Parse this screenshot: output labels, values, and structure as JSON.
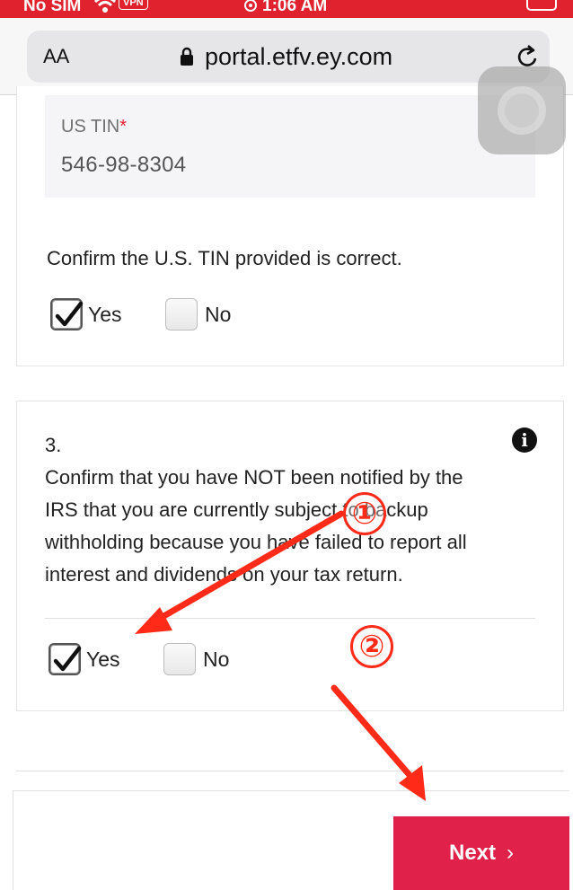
{
  "status_bar": {
    "carrier": "No SIM",
    "vpn": "VPN",
    "time": "1:06 AM"
  },
  "browser": {
    "text_size": "AA",
    "url": "portal.etfv.ey.com"
  },
  "tin": {
    "label": "US TIN",
    "required_mark": "*",
    "value": "546-98-8304"
  },
  "question2": {
    "prompt": "Confirm the U.S. TIN provided is correct.",
    "yes_label": "Yes",
    "yes_checked": true,
    "no_label": "No",
    "no_checked": false
  },
  "question3": {
    "number": "3.",
    "prompt_lines": [
      "Confirm that you have NOT been notified by the",
      "IRS that you are currently subject to backup",
      "withholding because you have failed to report all",
      "interest and dividends on your tax return."
    ],
    "yes_label": "Yes",
    "yes_checked": true,
    "no_label": "No",
    "no_checked": false
  },
  "next_button": {
    "label": "Next",
    "chevron": "›"
  },
  "annotations": {
    "step1": "①",
    "step2": "②",
    "color": "#ff2a18"
  },
  "colors": {
    "brand_red": "#e0222f",
    "next_button": "#e0224b"
  }
}
